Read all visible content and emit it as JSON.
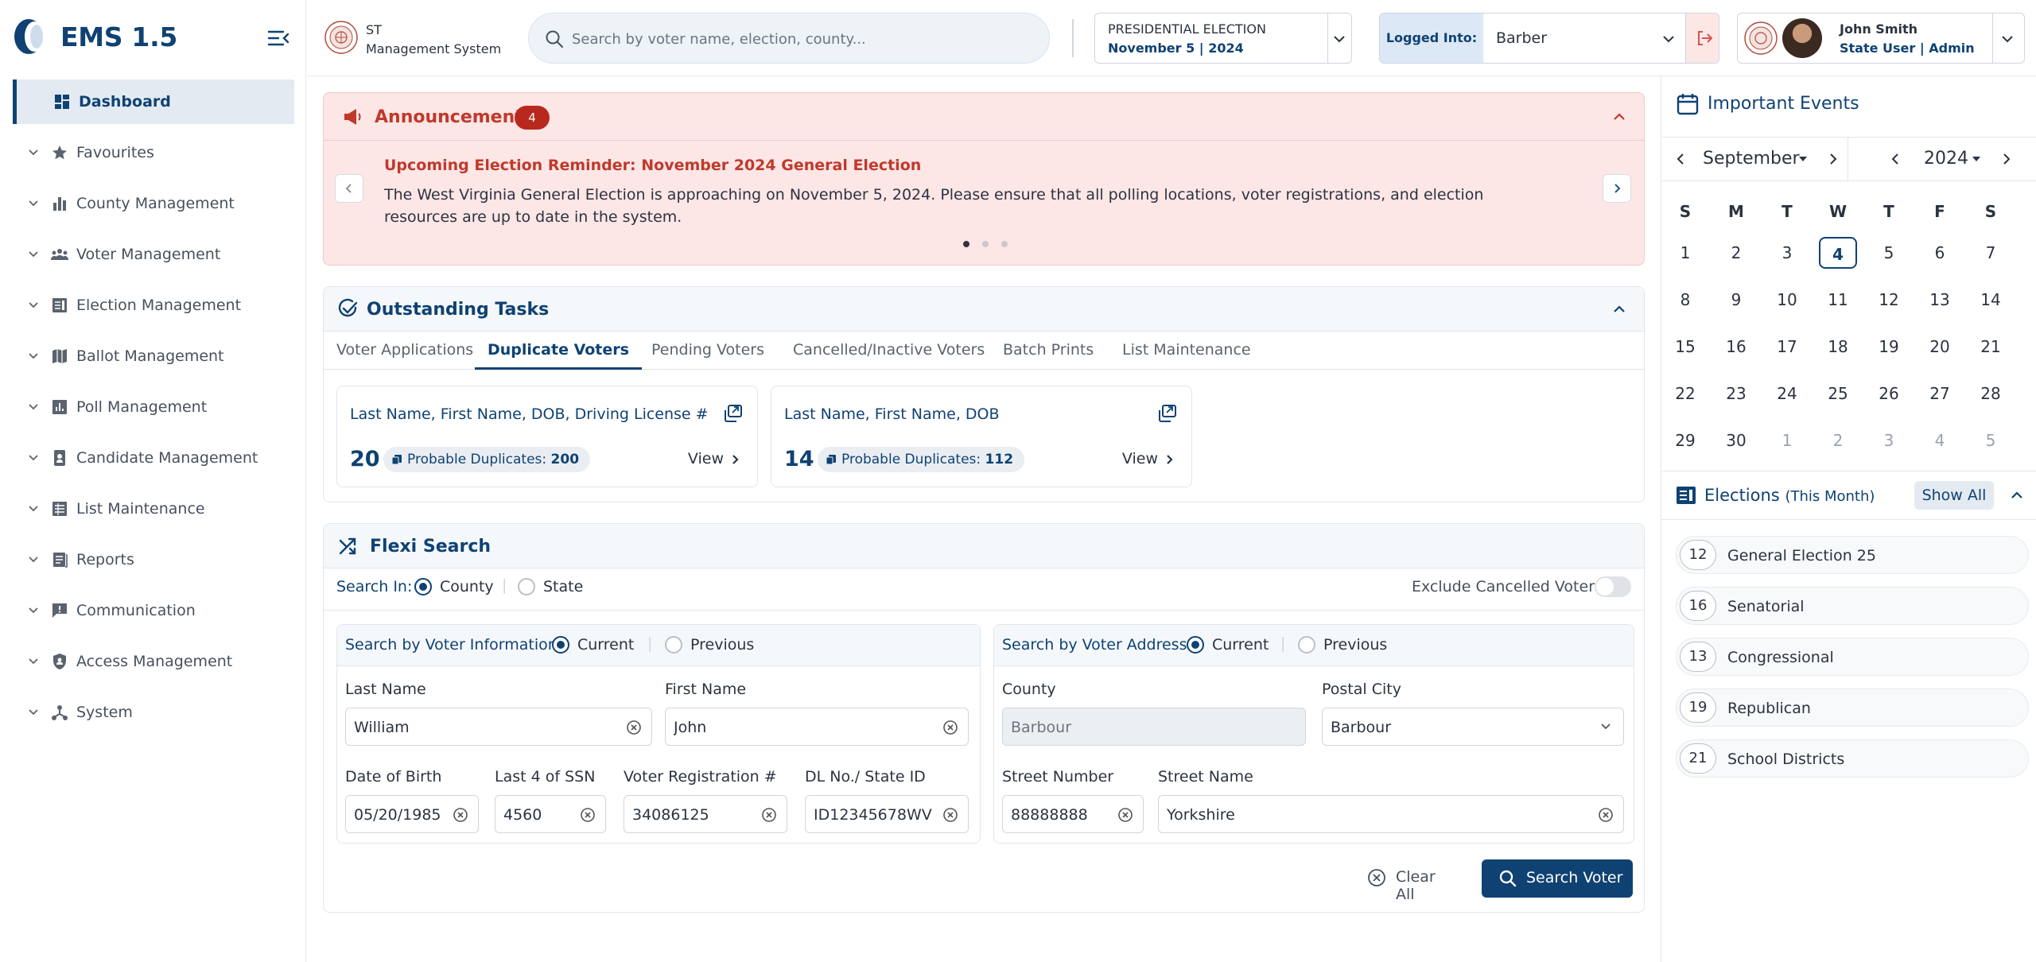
{
  "app": {
    "title": "EMS 1.5"
  },
  "sidebar": {
    "items": [
      {
        "label": "Dashboard",
        "icon": "dashboard-icon",
        "active": true
      },
      {
        "label": "Favourites",
        "icon": "star-icon"
      },
      {
        "label": "County Management",
        "icon": "bar-chart-icon"
      },
      {
        "label": "Voter Management",
        "icon": "users-icon"
      },
      {
        "label": "Election Management",
        "icon": "ballot-list-icon"
      },
      {
        "label": "Ballot Management",
        "icon": "map-icon"
      },
      {
        "label": "Poll Management",
        "icon": "poll-chart-icon"
      },
      {
        "label": "Candidate Management",
        "icon": "candidate-badge-icon"
      },
      {
        "label": "List Maintenance",
        "icon": "list-icon"
      },
      {
        "label": "Reports",
        "icon": "report-icon"
      },
      {
        "label": "Communication",
        "icon": "message-icon"
      },
      {
        "label": "Access Management",
        "icon": "shield-icon"
      },
      {
        "label": "System",
        "icon": "network-icon"
      }
    ]
  },
  "header": {
    "org_line1": "ST",
    "org_line2": "Management System",
    "search_placeholder": "Search by voter name, election, county...",
    "election_name": "PRESIDENTIAL ELECTION",
    "election_date": "November 5 | 2024",
    "logged_into_label": "Logged Into:",
    "logged_into_value": "Barber",
    "user_name": "John Smith",
    "user_role": "State User | Admin"
  },
  "announcements": {
    "title": "Announcements",
    "count": "4",
    "heading": "Upcoming Election Reminder: November 2024 General Election",
    "body": "The West Virginia General Election is approaching on November 5, 2024. Please ensure that all polling locations, voter registrations, and election resources are up to date in the system."
  },
  "tasks": {
    "title": "Outstanding Tasks",
    "tabs": [
      "Voter Applications",
      "Duplicate Voters",
      "Pending Voters",
      "Cancelled/Inactive Voters",
      "Batch Prints",
      "List Maintenance"
    ],
    "active_tab": "Duplicate Voters",
    "cards": [
      {
        "title": "Last Name, First Name, DOB, Driving License #",
        "count": "20",
        "pill_label": "Probable Duplicates:",
        "pill_value": "200",
        "view": "View"
      },
      {
        "title": "Last Name, First Name, DOB",
        "count": "14",
        "pill_label": "Probable Duplicates:",
        "pill_value": "112",
        "view": "View"
      }
    ]
  },
  "flexi": {
    "title": "Flexi Search",
    "search_in_label": "Search In:",
    "search_in_county": "County",
    "search_in_state": "State",
    "exclude_label": "Exclude Cancelled Voters",
    "voter_info_label": "Search by Voter Information:",
    "voter_addr_label": "Search by Voter Address:",
    "current": "Current",
    "previous": "Previous",
    "fields": {
      "last_name": {
        "label": "Last Name",
        "value": "William"
      },
      "first_name": {
        "label": "First Name",
        "value": "John"
      },
      "dob": {
        "label": "Date of Birth",
        "value": "05/20/1985"
      },
      "ssn": {
        "label": "Last 4 of SSN",
        "value": "4560"
      },
      "voter_reg": {
        "label": "Voter Registration #",
        "value": "34086125"
      },
      "dl": {
        "label": "DL No./ State ID",
        "value": "ID12345678WV"
      },
      "county": {
        "label": "County",
        "value": "Barbour"
      },
      "postal_city": {
        "label": "Postal  City",
        "value": "Barbour"
      },
      "street_number": {
        "label": "Street Number",
        "value": "88888888"
      },
      "street_name": {
        "label": "Street Name",
        "value": "Yorkshire"
      }
    },
    "clear_all": "Clear All",
    "search_voter": "Search Voter"
  },
  "events": {
    "title": "Important Events",
    "month": "September",
    "year": "2024",
    "weekdays": [
      "S",
      "M",
      "T",
      "W",
      "T",
      "F",
      "S"
    ],
    "days": [
      [
        1,
        2,
        3,
        4,
        5,
        6,
        7
      ],
      [
        8,
        9,
        10,
        11,
        12,
        13,
        14
      ],
      [
        15,
        16,
        17,
        18,
        19,
        20,
        21
      ],
      [
        22,
        23,
        24,
        25,
        26,
        27,
        28
      ],
      [
        29,
        30,
        1,
        2,
        3,
        4,
        5
      ]
    ],
    "today": 4
  },
  "elections": {
    "title": "Elections",
    "subtitle": "(This Month)",
    "show_all": "Show All",
    "items": [
      {
        "count": "12",
        "name": "General Election 25"
      },
      {
        "count": "16",
        "name": "Senatorial"
      },
      {
        "count": "13",
        "name": "Congressional"
      },
      {
        "count": "19",
        "name": "Republican"
      },
      {
        "count": "21",
        "name": "School Districts"
      }
    ]
  },
  "colors": {
    "primary": "#0f4273",
    "danger": "#c0392b",
    "announcement_bg": "#fde6e6"
  }
}
